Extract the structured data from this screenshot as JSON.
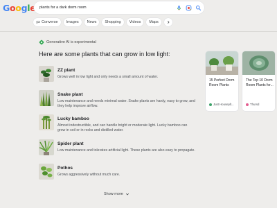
{
  "search": {
    "query": "plants for a dark dorm room",
    "icons": [
      "microphone-icon",
      "lens-icon",
      "search-icon"
    ]
  },
  "logo": {
    "letters": [
      "G",
      "o",
      "o",
      "g",
      "l",
      "e"
    ],
    "colors": [
      "#4285f4",
      "#ea4335",
      "#fbbc05",
      "#4285f4",
      "#34a853",
      "#ea4335"
    ]
  },
  "tabs": [
    {
      "label": "Converse",
      "icon": "converse-icon"
    },
    {
      "label": "Images"
    },
    {
      "label": "News"
    },
    {
      "label": "Shopping"
    },
    {
      "label": "Videos"
    },
    {
      "label": "Maps"
    }
  ],
  "ai": {
    "label": "Generative AI is experimental",
    "heading": "Here are some plants that can grow in low light:",
    "plants": [
      {
        "name": "ZZ plant",
        "desc": "Grows well in low light and only needs a small amount of water."
      },
      {
        "name": "Snake plant",
        "desc": "Low maintenance and needs minimal water. Snake plants are hardy, easy to grow, and they help improve airflow."
      },
      {
        "name": "Lucky bamboo",
        "desc": "Almost indestructible, and can handle bright or moderate light. Lucky bamboo can grow in soil or in rocks and distilled water."
      },
      {
        "name": "Spider plant",
        "desc": "Low maintenance and tolerates artificial light. These plants are also easy to propagate."
      },
      {
        "name": "Pothos",
        "desc": "Grows aggressively without much care."
      }
    ],
    "show_more": "Show more"
  },
  "cards": [
    {
      "title": "15 Perfect Dorm Room Plants",
      "source": "Just Houseplt...",
      "source_color": "#3fa36b"
    },
    {
      "title": "The Top 10 Dorm Room Plants for...",
      "source": "Thursd",
      "source_color": "#e35d8f"
    }
  ]
}
